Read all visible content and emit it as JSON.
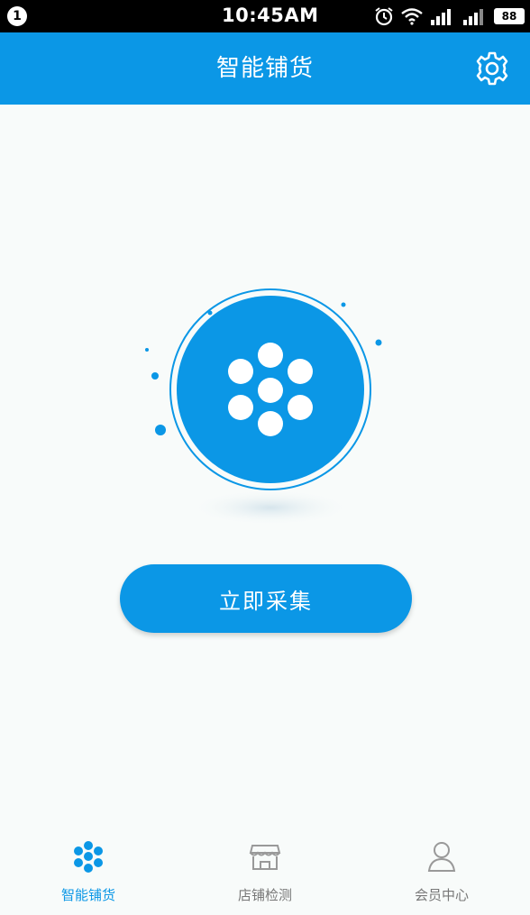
{
  "status_bar": {
    "notification_count": "1",
    "time": "10:45AM",
    "battery": "88",
    "icons": [
      "alarm-icon",
      "wifi-icon",
      "signal-icon",
      "signal-icon",
      "battery-icon"
    ]
  },
  "header": {
    "title": "智能铺货",
    "settings_icon": "gear-icon"
  },
  "main": {
    "hero_icon": "flower-dots-icon",
    "collect_button_label": "立即采集"
  },
  "bottom_nav": {
    "items": [
      {
        "label": "智能铺货",
        "icon": "flower-dots-icon",
        "active": true
      },
      {
        "label": "店铺检测",
        "icon": "shop-icon",
        "active": false
      },
      {
        "label": "会员中心",
        "icon": "user-icon",
        "active": false
      }
    ]
  },
  "colors": {
    "primary": "#0b97e6",
    "background": "#f8fbfa",
    "inactive_text": "#777777"
  }
}
